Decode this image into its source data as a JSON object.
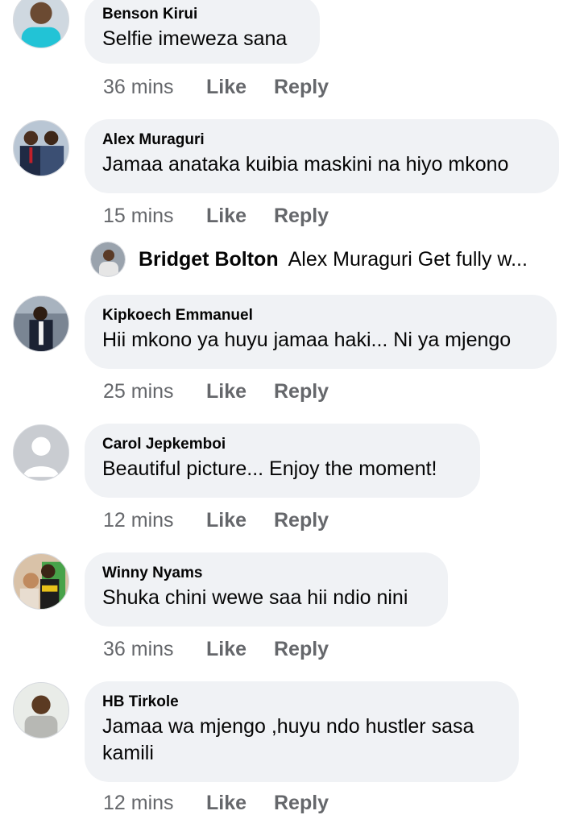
{
  "comments": [
    {
      "author": "Benson Kirui",
      "text": "Selfie imeweza sana",
      "time": "36 mins",
      "like": "Like",
      "reply": "Reply"
    },
    {
      "author": "Alex Muraguri",
      "text": "Jamaa anataka kuibia maskini na hiyo mkono",
      "time": "15 mins",
      "like": "Like",
      "reply": "Reply"
    },
    {
      "author": "Kipkoech Emmanuel",
      "text": "Hii mkono ya huyu jamaa haki... Ni ya mjengo",
      "time": "25 mins",
      "like": "Like",
      "reply": "Reply"
    },
    {
      "author": "Carol Jepkemboi",
      "text": "Beautiful picture... Enjoy the moment!",
      "time": "12 mins",
      "like": "Like",
      "reply": "Reply"
    },
    {
      "author": "Winny Nyams",
      "text": "Shuka chini wewe saa hii ndio nini",
      "time": "36 mins",
      "like": "Like",
      "reply": "Reply"
    },
    {
      "author": "HB Tirkole",
      "text": "Jamaa wa mjengo ,huyu ndo hustler sasa kamili",
      "time": "12 mins",
      "like": "Like",
      "reply": "Reply"
    }
  ],
  "reply_preview": {
    "author": "Bridget Bolton",
    "text": "Alex Muraguri Get fully w..."
  }
}
